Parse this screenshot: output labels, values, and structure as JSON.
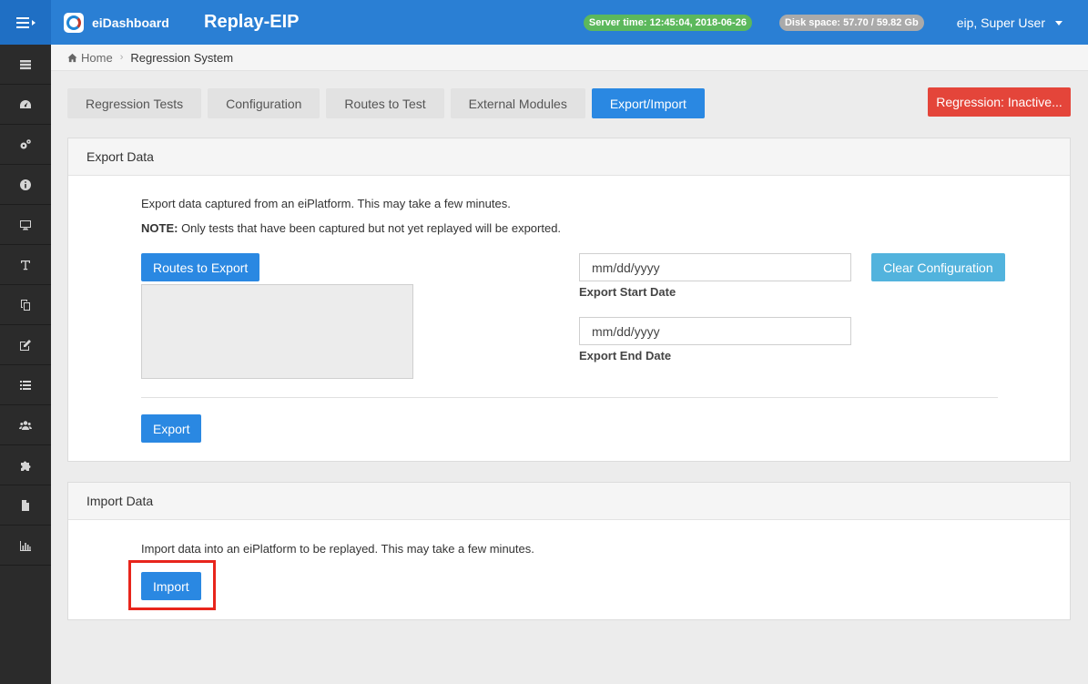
{
  "topbar": {
    "brand": "eiDashboard",
    "app_title": "Replay-EIP",
    "server_time": "Server time: 12:45:04, 2018-06-26",
    "disk_space": "Disk space: 57.70 / 59.82 Gb",
    "user": "eip, Super User"
  },
  "sidebar": {
    "items": [
      "server-icon",
      "dashboard-icon",
      "cogs-icon",
      "info-icon",
      "monitor-icon",
      "text-icon",
      "copy-icon",
      "edit-icon",
      "list-icon",
      "users-icon",
      "puzzle-icon",
      "file-icon",
      "bar-chart-icon"
    ]
  },
  "breadcrumb": {
    "home": "Home",
    "current": "Regression System"
  },
  "tabs": [
    "Regression Tests",
    "Configuration",
    "Routes to Test",
    "External Modules",
    "Export/Import"
  ],
  "active_tab": "Export/Import",
  "regression_button": "Regression: Inactive...",
  "export_panel": {
    "title": "Export Data",
    "description": "Export data captured from an eiPlatform. This may take a few minutes.",
    "note_label": "NOTE:",
    "note_text": " Only tests that have been captured but not yet replayed will be exported.",
    "routes_button": "Routes to Export",
    "start_date_placeholder": "mm/dd/yyyy",
    "start_date_label": "Export Start Date",
    "end_date_placeholder": "mm/dd/yyyy",
    "end_date_label": "Export End Date",
    "clear_button": "Clear Configuration",
    "export_button": "Export"
  },
  "import_panel": {
    "title": "Import Data",
    "description": "Import data into an eiPlatform to be replayed. This may take a few minutes.",
    "import_button": "Import"
  },
  "colors": {
    "topbar": "#2a7fd4",
    "primary": "#2a88e2",
    "danger": "#e4453a",
    "success": "#5cb85c",
    "highlight": "#e8251c"
  }
}
